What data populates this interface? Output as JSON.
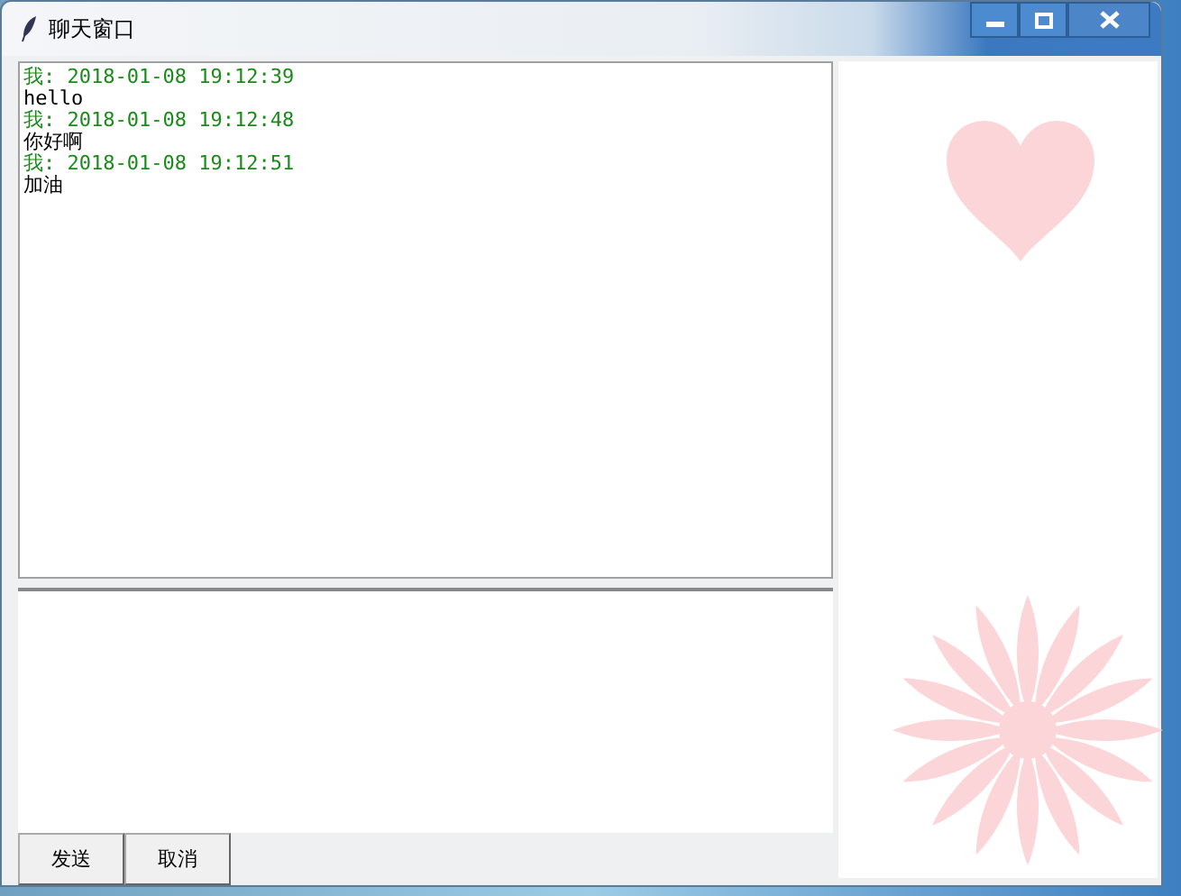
{
  "window": {
    "title": "聊天窗口"
  },
  "messages": [
    {
      "kind": "header",
      "text": "我: 2018-01-08 19:12:39"
    },
    {
      "kind": "body",
      "text": "hello"
    },
    {
      "kind": "header",
      "text": "我: 2018-01-08 19:12:48"
    },
    {
      "kind": "body",
      "text": "你好啊"
    },
    {
      "kind": "header",
      "text": "我: 2018-01-08 19:12:51"
    },
    {
      "kind": "body",
      "text": "加油"
    }
  ],
  "buttons": [
    "发送",
    "取消"
  ]
}
